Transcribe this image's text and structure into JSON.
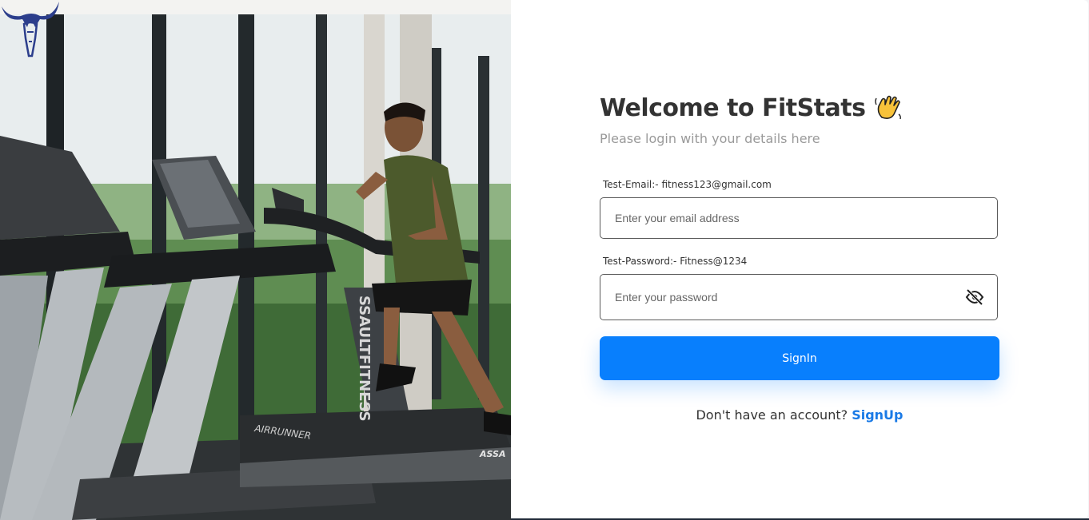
{
  "app": {
    "name": "FitStats"
  },
  "login": {
    "title": "Welcome to FitStats",
    "subtitle": "Please login with your details here",
    "email_hint": "Test-Email:- fitness123@gmail.com",
    "email_placeholder": "Enter your email address",
    "email_value": "",
    "password_hint": "Test-Password:- Fitness@1234",
    "password_placeholder": "Enter your password",
    "password_value": "",
    "signin_label": "SignIn",
    "no_account_text": "Don't have an account?",
    "signup_label": "SignUp"
  },
  "hero": {
    "treadmill_brand_vertical": "SSAULTFITNESS",
    "treadmill_model": "AIRRUNNER",
    "corner_brand": "ASSA"
  },
  "icons": {
    "logo": "bull-logo-icon",
    "wave": "waving-hand-emoji-icon",
    "password_toggle": "eye-off-icon"
  },
  "colors": {
    "primary": "#087ffd",
    "link": "#1a7ae6",
    "title": "#333333",
    "subtitle": "#9a9a9a",
    "panel_bg": "#ffffff"
  }
}
